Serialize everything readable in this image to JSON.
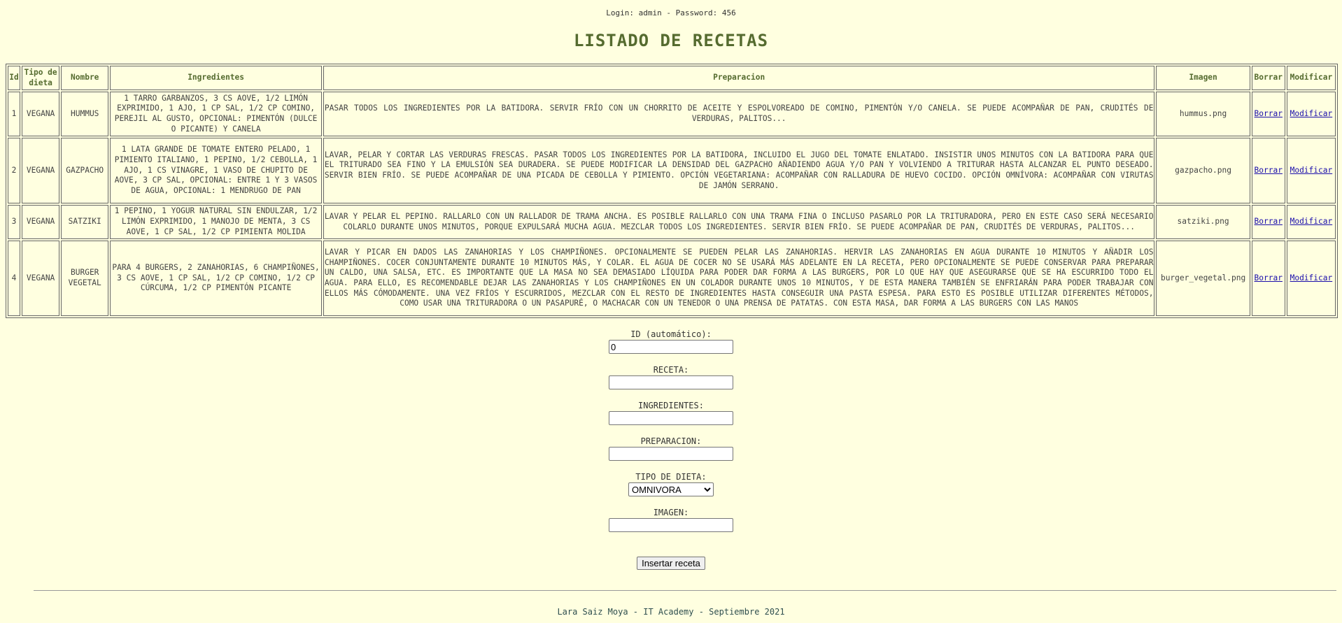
{
  "login_info": "Login: admin - Password: 456",
  "title": "LISTADO DE RECETAS",
  "table": {
    "headers": {
      "id": "Id",
      "tipo_1": "Tipo de",
      "tipo_2": "dieta",
      "nombre": "Nombre",
      "ingredientes": "Ingredientes",
      "preparacion": "Preparacion",
      "imagen": "Imagen",
      "borrar": "Borrar",
      "modificar": "Modificar"
    },
    "rows": [
      {
        "id": "1",
        "tipo": "VEGANA",
        "nombre": "HUMMUS",
        "ingredientes": "1 TARRO GARBANZOS, 3 CS AOVE, 1/2 LIMÓN EXPRIMIDO, 1 AJO, 1 CP SAL, 1/2 CP COMINO, PEREJIL AL GUSTO, OPCIONAL: PIMENTÓN (DULCE O PICANTE) Y CANELA",
        "preparacion": "PASAR TODOS LOS INGREDIENTES POR LA BATIDORA. SERVIR FRÍO CON UN CHORRITO DE ACEITE Y ESPOLVOREADO DE COMINO, PIMENTÓN Y/O CANELA. SE PUEDE ACOMPAÑAR DE PAN, CRUDITÉS DE VERDURAS, PALITOS...",
        "imagen": "hummus.png",
        "borrar": "Borrar",
        "modificar": "Modificar"
      },
      {
        "id": "2",
        "tipo": "VEGANA",
        "nombre": "GAZPACHO",
        "ingredientes": "1 LATA GRANDE DE TOMATE ENTERO PELADO, 1 PIMIENTO ITALIANO, 1 PEPINO, 1/2 CEBOLLA, 1 AJO, 1 CS VINAGRE, 1 VASO DE CHUPITO DE AOVE, 3 CP SAL, OPCIONAL: ENTRE 1 Y 3 VASOS DE AGUA, OPCIONAL: 1 MENDRUGO DE PAN",
        "preparacion": "LAVAR, PELAR Y CORTAR LAS VERDURAS FRESCAS. PASAR TODOS LOS INGREDIENTES POR LA BATIDORA, INCLUIDO EL JUGO DEL TOMATE ENLATADO. INSISTIR UNOS MINUTOS CON LA BATIDORA PARA QUE EL TRITURADO SEA FINO Y LA EMULSIÓN SEA DURADERA. SE PUEDE MODIFICAR LA DENSIDAD DEL GAZPACHO AÑADIENDO AGUA Y/O PAN Y VOLVIENDO A TRITURAR HASTA ALCANZAR EL PUNTO DESEADO. SERVIR BIEN FRÍO. SE PUEDE ACOMPAÑAR DE UNA PICADA DE CEBOLLA Y PIMIENTO. OPCIÓN VEGETARIANA: ACOMPAÑAR CON RALLADURA DE HUEVO COCIDO. OPCIÓN OMNÍVORA: ACOMPAÑAR CON VIRUTAS DE JAMÓN SERRANO.",
        "imagen": "gazpacho.png",
        "borrar": "Borrar",
        "modificar": "Modificar"
      },
      {
        "id": "3",
        "tipo": "VEGANA",
        "nombre": "SATZIKI",
        "ingredientes": "1 PEPINO, 1 YOGUR NATURAL SIN ENDULZAR, 1/2 LIMÓN EXPRIMIDO, 1 MANOJO DE MENTA, 3 CS AOVE, 1 CP SAL, 1/2 CP PIMIENTA MOLIDA",
        "preparacion": "LAVAR Y PELAR EL PEPINO. RALLARLO CON UN RALLADOR DE TRAMA ANCHA. ES POSIBLE RALLARLO CON UNA TRAMA FINA O INCLUSO PASARLO POR LA TRITURADORA, PERO EN ESTE CASO SERÁ NECESARIO COLARLO DURANTE UNOS MINUTOS, PORQUE EXPULSARÁ MUCHA AGUA. MEZCLAR TODOS LOS INGREDIENTES. SERVIR BIEN FRÍO. SE PUEDE ACOMPAÑAR DE PAN, CRUDITÉS DE VERDURAS, PALITOS...",
        "imagen": "satziki.png",
        "borrar": "Borrar",
        "modificar": "Modificar"
      },
      {
        "id": "4",
        "tipo": "VEGANA",
        "nombre": "BURGER VEGETAL",
        "ingredientes": "PARA 4 BURGERS, 2 ZANAHORIAS, 6 CHAMPIÑONES, 3 CS AOVE, 1 CP SAL, 1/2 CP COMINO, 1/2 CP CÚRCUMA, 1/2 CP PIMENTÓN PICANTE",
        "preparacion": "LAVAR Y PICAR EN DADOS LAS ZANAHORIAS Y LOS CHAMPIÑONES. OPCIONALMENTE SE PUEDEN PELAR LAS ZANAHORIAS. HERVIR LAS ZANAHORIAS EN AGUA DURANTE 10 MINUTOS Y AÑADIR LOS CHAMPIÑONES. COCER CONJUNTAMENTE DURANTE 10 MINUTOS MÁS, Y COLAR. EL AGUA DE COCER NO SE USARÁ MÁS ADELANTE EN LA RECETA, PERO OPCIONALMENTE SE PUEDE CONSERVAR PARA PREPARAR UN CALDO, UNA SALSA, ETC. ES IMPORTANTE QUE LA MASA NO SEA DEMASIADO LÍQUIDA PARA PODER DAR FORMA A LAS BURGERS, POR LO QUE HAY QUE ASEGURARSE QUE SE HA ESCURRIDO TODO EL AGUA. PARA ELLO, ES RECOMENDABLE DEJAR LAS ZANAHORIAS Y LOS CHAMPIÑONES EN UN COLADOR DURANTE UNOS 10 MINUTOS, Y DE ESTA MANERA TAMBIÉN SE ENFRIARÁN PARA PODER TRABAJAR CON ELLOS MÁS CÓMODAMENTE. UNA VEZ FRÍOS Y ESCURRIDOS, MEZCLAR CON EL RESTO DE INGREDIENTES HASTA CONSEGUIR UNA PASTA ESPESA. PARA ESTO ES POSIBLE UTILIZAR DIFERENTES MÉTODOS, COMO USAR UNA TRITURADORA O UN PASAPURÉ, O MACHACAR CON UN TENEDOR O UNA PRENSA DE PATATAS. CON ESTA MASA, DAR FORMA A LAS BURGERS CON LAS MANOS",
        "imagen": "burger_vegetal.png",
        "borrar": "Borrar",
        "modificar": "Modificar"
      }
    ]
  },
  "form": {
    "id_label": "ID (automático):",
    "id_value": "0",
    "receta_label": "RECETA:",
    "receta_value": "",
    "ingredientes_label": "INGREDIENTES:",
    "ingredientes_value": "",
    "preparacion_label": "PREPARACION:",
    "preparacion_value": "",
    "tipo_label": "TIPO DE DIETA:",
    "tipo_selected": "OMNIVORA",
    "imagen_label": "IMAGEN:",
    "imagen_value": "",
    "submit_label": "Insertar receta"
  },
  "footer": "Lara Saiz Moya - IT Academy - Septiembre 2021",
  "colors": {
    "background": "#ffffe0",
    "heading": "#556b2f",
    "link": "#1a0dab",
    "footer": "#2f4f4f"
  }
}
